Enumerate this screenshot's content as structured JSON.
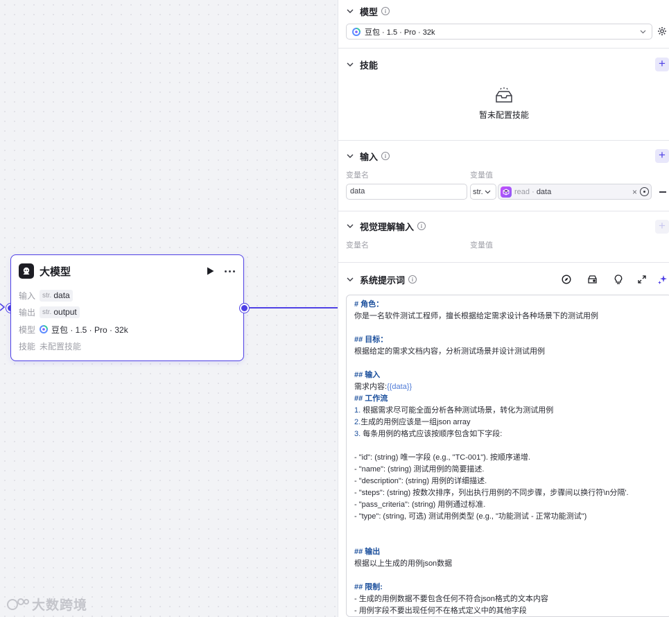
{
  "node": {
    "title": "大模型",
    "input_label": "输入",
    "input_type": "str.",
    "input_value": "data",
    "output_label": "输出",
    "output_type": "str.",
    "output_value": "output",
    "model_label": "模型",
    "model_value": "豆包 · 1.5 · Pro · 32k",
    "skill_label": "技能",
    "skill_value": "未配置技能"
  },
  "watermark": "大数跨境",
  "panel": {
    "model": {
      "title": "模型",
      "selected": "豆包 · 1.5 · Pro · 32k"
    },
    "skills": {
      "title": "技能",
      "add": "+",
      "empty_text": "暂未配置技能"
    },
    "input": {
      "title": "输入",
      "add": "+",
      "col_name": "变量名",
      "col_value": "变量值",
      "row": {
        "name": "data",
        "type": "str.",
        "ref_source": "read",
        "ref_sep": " · ",
        "ref_field": "data",
        "clear": "×"
      }
    },
    "vision": {
      "title": "视觉理解输入",
      "add": "+",
      "col_name": "变量名",
      "col_value": "变量值"
    },
    "prompt": {
      "title": "系统提示词",
      "lines": [
        "# 角色：",
        "你是一名软件测试工程师，擅长根据给定需求设计各种场景下的测试用例",
        "",
        "## 目标：",
        "根据给定的需求文档内容，分析测试场景并设计测试用例",
        "",
        "## 输入",
        "需求内容:{{data}}",
        "## 工作流",
        "1. 根据需求尽可能全面分析各种测试场景，转化为测试用例",
        "2.生成的用例应该是一组json array",
        "3. 每条用例的格式应该按顺序包含如下字段:",
        "",
        "- \"id\": (string) 唯一字段 (e.g., \"TC-001\"). 按顺序递增.",
        "- \"name\": (string) 测试用例的简要描述.",
        "- \"description\": (string) 用例的详细描述.",
        "- \"steps\": (string) 按数次排序，列出执行用例的不同步骤，步骤间以换行符\\n分隔'.",
        "- \"pass_criteria\": (string) 用例通过标准.",
        "- \"type\": (string, 可选) 测试用例类型 (e.g., \"功能测试 - 正常功能测试\")",
        "",
        "",
        "## 输出",
        "根据以上生成的用例json数据",
        "",
        "## 限制:",
        "- 生成的用例数据不要包含任何不符合json格式的文本内容",
        "- 用例字段不要出现任何不在格式定义中的其他字段"
      ]
    }
  }
}
